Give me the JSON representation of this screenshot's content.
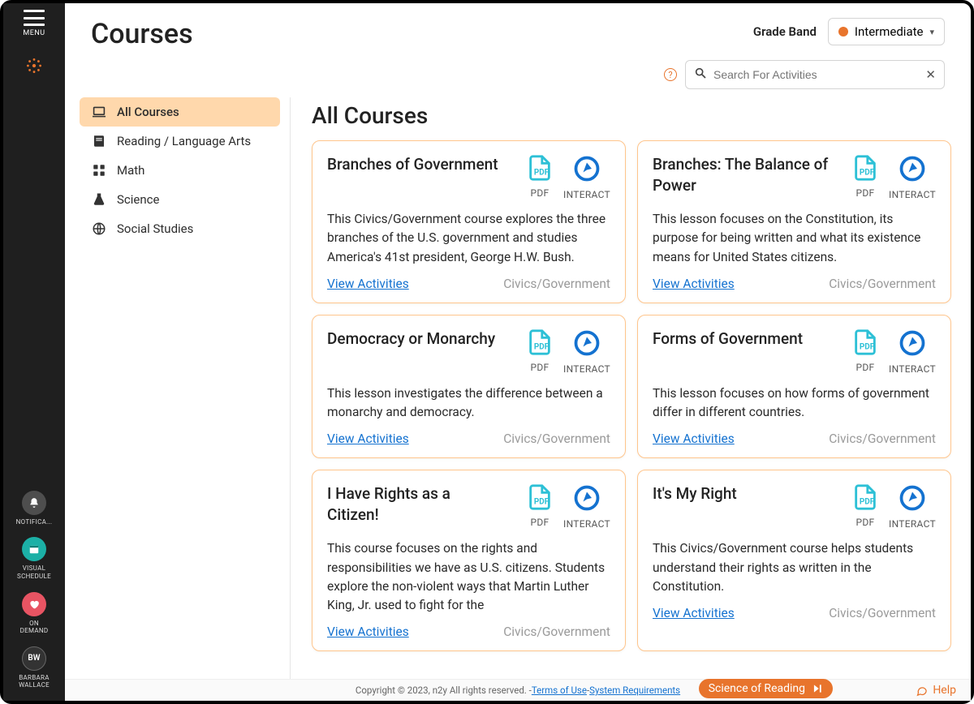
{
  "rail": {
    "menu_label": "MENU",
    "items": [
      {
        "id": "notifications",
        "label": "NOTIFICA..."
      },
      {
        "id": "visual_schedule",
        "label": "VISUAL\nSCHEDULE"
      },
      {
        "id": "on_demand",
        "label": "ON\nDEMAND"
      }
    ],
    "user": {
      "initials": "BW",
      "name": "BARBARA\nWALLACE"
    }
  },
  "header": {
    "page_title": "Courses",
    "grade_label": "Grade Band",
    "grade_value": "Intermediate",
    "search_placeholder": "Search For Activities"
  },
  "sidebar": {
    "items": [
      {
        "id": "all",
        "label": "All Courses",
        "active": true
      },
      {
        "id": "reading",
        "label": "Reading / Language Arts"
      },
      {
        "id": "math",
        "label": "Math"
      },
      {
        "id": "science",
        "label": "Science"
      },
      {
        "id": "social",
        "label": "Social Studies"
      }
    ]
  },
  "section_title": "All Courses",
  "icon_labels": {
    "pdf": "PDF",
    "interact": "INTERACT"
  },
  "view_link_label": "View Activities",
  "courses": [
    {
      "title": "Branches of Government",
      "desc": "This Civics/Government course explores the three branches of the U.S. government and studies America's 41st president, George H.W. Bush.",
      "subject": "Civics/Government"
    },
    {
      "title": "Branches: The Balance of Power",
      "desc": "This lesson focuses on the Constitution, its purpose for being written and what its existence means for United States citizens.",
      "subject": "Civics/Government"
    },
    {
      "title": "Democracy or Monarchy",
      "desc": "This lesson investigates the difference between a monarchy and democracy.",
      "subject": "Civics/Government"
    },
    {
      "title": "Forms of Government",
      "desc": "This lesson focuses on how forms of government differ in different countries.",
      "subject": "Civics/Government"
    },
    {
      "title": "I Have Rights as a Citizen!",
      "desc": "This course focuses on the rights and responsibilities we have as U.S. citizens. Students explore the non-violent ways that Martin Luther King, Jr. used to fight for the",
      "subject": "Civics/Government"
    },
    {
      "title": "It's My Right",
      "desc": "This Civics/Government course helps students understand their rights as written in the Constitution.",
      "subject": "Civics/Government"
    }
  ],
  "footer": {
    "copyright": "Copyright © 2023, n2y All rights reserved. - ",
    "terms": "Terms of Use",
    "sep": " - ",
    "sysreq": "System Requirements",
    "sor_label": "Science of Reading",
    "help_label": "Help"
  }
}
